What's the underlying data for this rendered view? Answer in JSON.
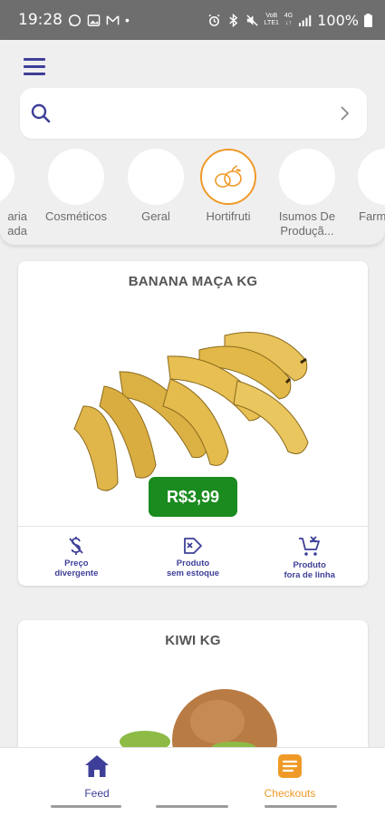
{
  "status_bar": {
    "time": "19:28",
    "network_top": "VoB",
    "network_bottom": "LTE1",
    "network_4g": "4G",
    "network_4g_sub": "↓↑",
    "battery": "100%"
  },
  "search": {
    "placeholder": "",
    "value": ""
  },
  "categories": [
    {
      "label": "aria\nada",
      "active": false
    },
    {
      "label": "Cosméticos",
      "active": false
    },
    {
      "label": "Geral",
      "active": false
    },
    {
      "label": "Hortifruti",
      "active": true,
      "icon": "fruits-icon"
    },
    {
      "label": "Isumos De\nProduçã...",
      "active": false
    },
    {
      "label": "Farm",
      "active": false
    }
  ],
  "products": [
    {
      "name": "BANANA MAÇA KG",
      "price": "R$3,99",
      "image": "banana-image"
    },
    {
      "name": "KIWI KG",
      "image": "kiwi-image"
    }
  ],
  "actions": [
    {
      "icon": "dollar-slash-icon",
      "label": "Preço\ndivergente"
    },
    {
      "icon": "tag-x-icon",
      "label": "Produto\nsem estoque"
    },
    {
      "icon": "cart-x-icon",
      "label": "Produto\nfora de linha"
    }
  ],
  "bottom_nav": {
    "feed_label": "Feed",
    "checkouts_label": "Checkouts"
  },
  "colors": {
    "brand_blue": "#3e3f98",
    "accent_orange": "#ef9a28",
    "price_green": "#1a8b1f",
    "status_bar": "#6e6e6e"
  }
}
